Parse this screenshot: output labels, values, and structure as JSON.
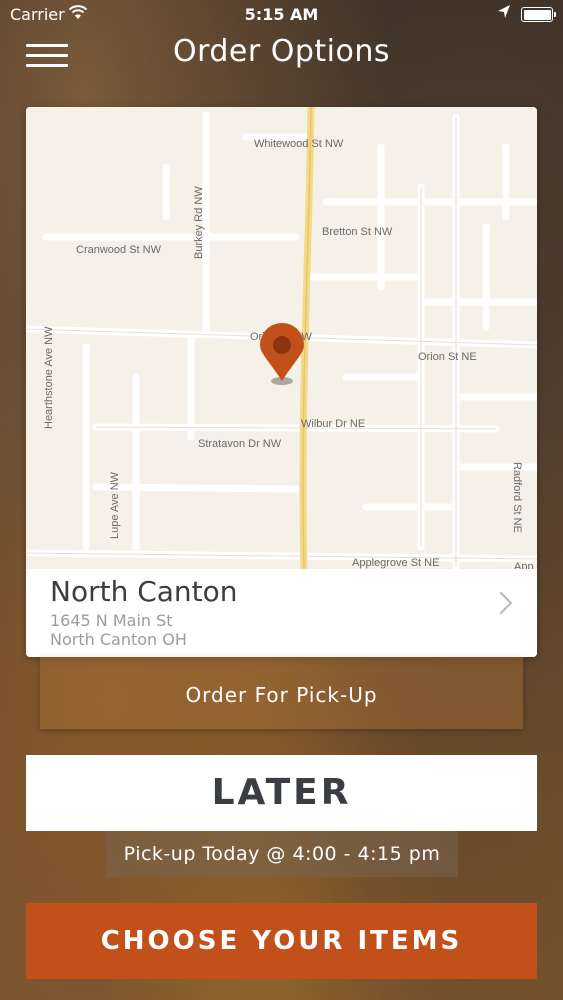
{
  "status_bar": {
    "carrier": "Carrier",
    "time": "5:15 AM"
  },
  "header": {
    "title": "Order Options"
  },
  "map": {
    "streets": [
      "Whitewood St NW",
      "Bretton St NW",
      "Cranwood St NW",
      "Burkey Rd NW",
      "Orion St NW",
      "Orion St NE",
      "Hearthstone Ave NW",
      "Wilbur Dr NE",
      "Stratavon Dr NW",
      "Lupe Ave NW",
      "Radford St NE",
      "Applegrove St NE",
      "App"
    ]
  },
  "store": {
    "name": "North Canton",
    "address_line1": "1645 N Main St",
    "address_line2": "North Canton OH"
  },
  "order_type": "Order For Pick-Up",
  "timing": {
    "button_label": "LATER",
    "pickup_time": "Pick-up Today @ 4:00 - 4:15 pm"
  },
  "cta": {
    "label": "CHOOSE YOUR ITEMS"
  },
  "colors": {
    "accent": "#c2501b",
    "map_pin": "#c2501b"
  }
}
